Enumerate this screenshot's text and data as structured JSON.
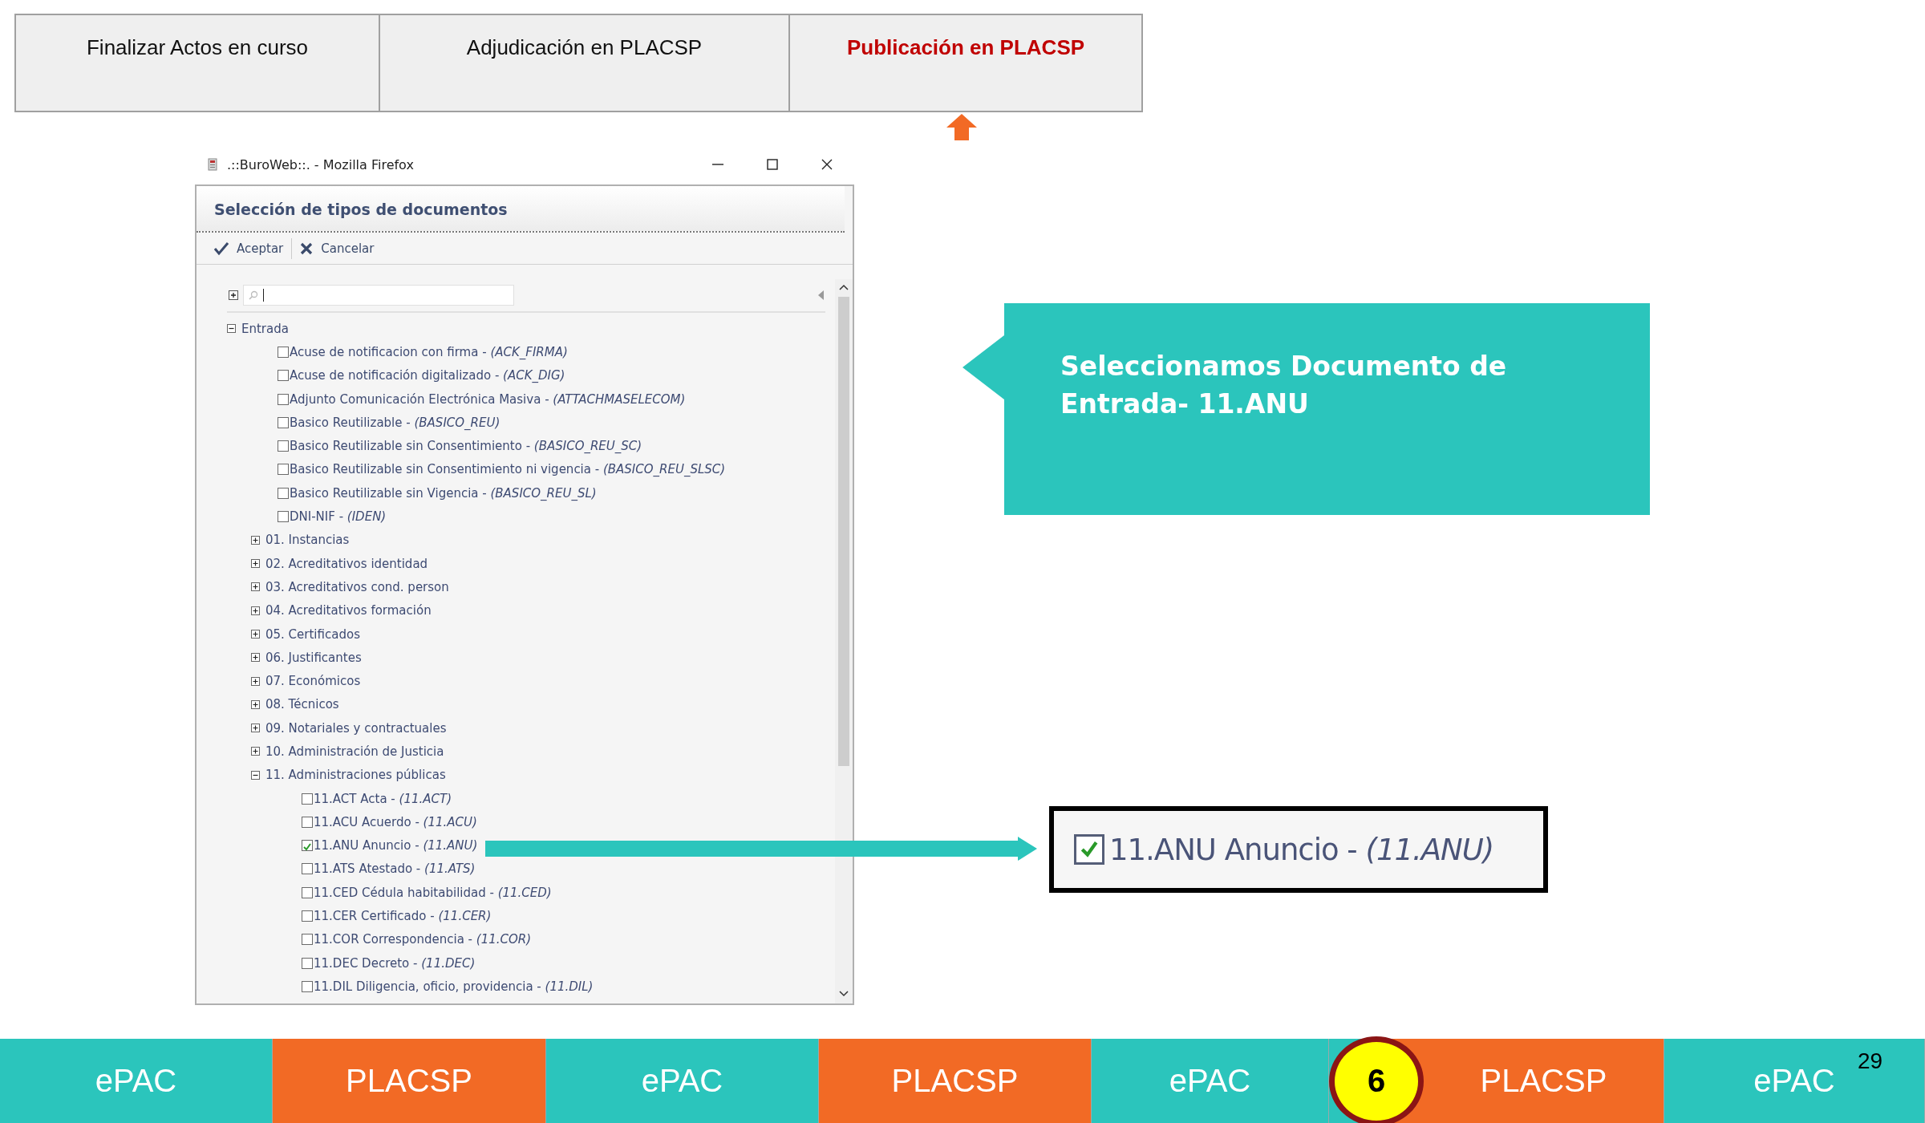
{
  "header_tabs": [
    {
      "label": "Finalizar Actos en curso",
      "selected": false
    },
    {
      "label": "Adjudicación en PLACSP",
      "selected": false
    },
    {
      "label": "Publicación en PLACSP",
      "selected": true
    }
  ],
  "window": {
    "title": ".::BuroWeb::. - Mozilla Firefox"
  },
  "dialog": {
    "title": "Selección de tipos de documentos",
    "toolbar": [
      {
        "kind": "accept",
        "label": "Aceptar"
      },
      {
        "kind": "cancel",
        "label": "Cancelar"
      }
    ],
    "tree": [
      {
        "kind": "group",
        "label": "Entrada",
        "expanded": true,
        "children": [
          {
            "kind": "doc",
            "label": "Acuse de notificacion con firma - *(ACK_FIRMA)*",
            "checked": false
          },
          {
            "kind": "doc",
            "label": "Acuse de notificación digitalizado - *(ACK_DIG)*",
            "checked": false
          },
          {
            "kind": "doc",
            "label": "Adjunto Comunicación Electrónica Masiva - *(ATTACHMASELECOM)*",
            "checked": false
          },
          {
            "kind": "doc",
            "label": "Basico Reutilizable - *(BASICO_REU)*",
            "checked": false
          },
          {
            "kind": "doc",
            "label": "Basico Reutilizable sin Consentimiento - *(BASICO_REU_SC)*",
            "checked": false
          },
          {
            "kind": "doc",
            "label": "Basico Reutilizable sin Consentimiento ni vigencia - *(BASICO_REU_SLSC)*",
            "checked": false
          },
          {
            "kind": "doc",
            "label": "Basico Reutilizable sin Vigencia - *(BASICO_REU_SL)*",
            "checked": false
          },
          {
            "kind": "doc",
            "label": "DNI-NIF - *(IDEN)*",
            "checked": false
          },
          {
            "kind": "group",
            "label": "01. Instancias",
            "expanded": false
          },
          {
            "kind": "group",
            "label": "02. Acreditativos identidad",
            "expanded": false
          },
          {
            "kind": "group",
            "label": "03. Acreditativos cond. person",
            "expanded": false
          },
          {
            "kind": "group",
            "label": "04. Acreditativos formación",
            "expanded": false
          },
          {
            "kind": "group",
            "label": "05. Certificados",
            "expanded": false
          },
          {
            "kind": "group",
            "label": "06. Justificantes",
            "expanded": false
          },
          {
            "kind": "group",
            "label": "07. Económicos",
            "expanded": false
          },
          {
            "kind": "group",
            "label": "08. Técnicos",
            "expanded": false
          },
          {
            "kind": "group",
            "label": "09. Notariales y contractuales",
            "expanded": false
          },
          {
            "kind": "group",
            "label": "10. Administración de Justicia",
            "expanded": false
          },
          {
            "kind": "group",
            "label": "11. Administraciones públicas",
            "expanded": true,
            "children": [
              {
                "kind": "doc",
                "label": "11.ACT Acta - *(11.ACT)*",
                "checked": false
              },
              {
                "kind": "doc",
                "label": "11.ACU Acuerdo - *(11.ACU)*",
                "checked": false
              },
              {
                "kind": "doc",
                "label": "11.ANU Anuncio - *(11.ANU)*",
                "checked": true
              },
              {
                "kind": "doc",
                "label": "11.ATS Atestado - *(11.ATS)*",
                "checked": false
              },
              {
                "kind": "doc",
                "label": "11.CED Cédula habitabilidad - *(11.CED)*",
                "checked": false
              },
              {
                "kind": "doc",
                "label": "11.CER Certificado - *(11.CER)*",
                "checked": false
              },
              {
                "kind": "doc",
                "label": "11.COR Correspondencia - *(11.COR)*",
                "checked": false
              },
              {
                "kind": "doc",
                "label": "11.DEC Decreto - *(11.DEC)*",
                "checked": false
              },
              {
                "kind": "doc",
                "label": "11.DIL Diligencia, oficio, providencia - *(11.DIL)*",
                "checked": false
              }
            ]
          }
        ]
      }
    ]
  },
  "callout": {
    "text": "Seleccionamos Documento de Entrada- 11.ANU"
  },
  "zoom_detail": {
    "label": "11.ANU Anuncio - *(11.ANU)*",
    "checked": true
  },
  "footer_tabs": [
    {
      "label": "ePAC",
      "color": "#2bc5bc"
    },
    {
      "label": "PLACSP",
      "color": "#f26a25"
    },
    {
      "label": "ePAC",
      "color": "#2bc5bc"
    },
    {
      "label": "PLACSP",
      "color": "#f26a25"
    },
    {
      "label": "ePAC",
      "color": "#2bc5bc"
    },
    {
      "label": "PLACSP",
      "color": "#f26a25"
    },
    {
      "label": "ePAC",
      "color": "#2bc5bc"
    }
  ],
  "step_badge": "6",
  "page_number": "29"
}
